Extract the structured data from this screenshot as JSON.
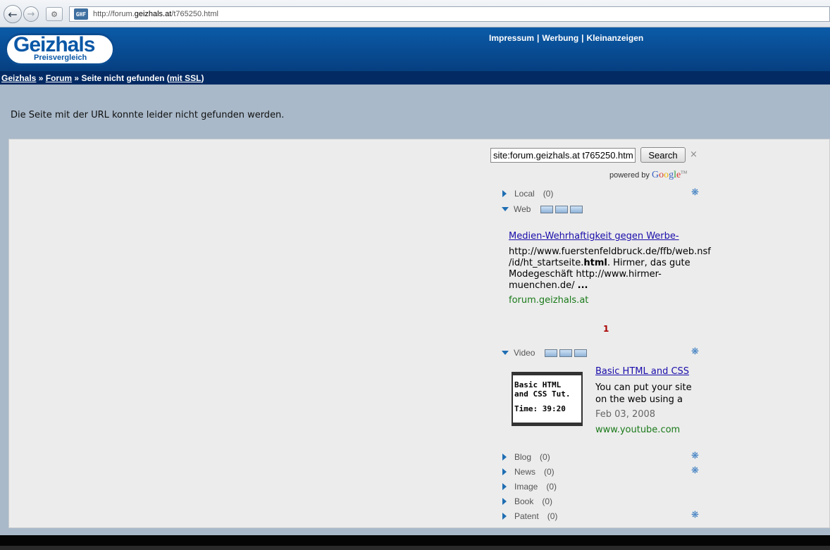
{
  "browser": {
    "url_prefix": "http://forum.",
    "url_domain": "geizhals.at",
    "url_path": "/t765250.html",
    "favicon_text": "GHF"
  },
  "header": {
    "logo_main": "Geizhals",
    "logo_sub": "Preisvergleich",
    "links": [
      "Impressum",
      "Werbung",
      "Kleinanzeigen"
    ]
  },
  "breadcrumb": {
    "home": "Geizhals",
    "sep": "»",
    "forum": "Forum",
    "current": "Seite nicht gefunden (",
    "ssl": "mit SSL",
    "close_paren": ")"
  },
  "message": "Die Seite mit der URL konnte leider nicht gefunden werden.",
  "search": {
    "query": "site:forum.geizhals.at t765250.html",
    "button": "Search",
    "clear": "×",
    "powered_by": "powered by"
  },
  "categories": {
    "local": {
      "label": "Local",
      "count": "(0)"
    },
    "web": {
      "label": "Web"
    },
    "video": {
      "label": "Video"
    },
    "blog": {
      "label": "Blog",
      "count": "(0)"
    },
    "news": {
      "label": "News",
      "count": "(0)"
    },
    "image": {
      "label": "Image",
      "count": "(0)"
    },
    "book": {
      "label": "Book",
      "count": "(0)"
    },
    "patent": {
      "label": "Patent",
      "count": "(0)"
    }
  },
  "web_result": {
    "title": "Medien-Wehrhaftigkeit gegen Werbe-",
    "snippet_1": "http://www.fuerstenfeldbruck.de/ffb/web.nsf /id/ht_startseite.",
    "snippet_bold": "html",
    "snippet_2": ". Hirmer, das gute Modegeschäft http://www.hirmer-muenchen.de/ ",
    "snippet_ellipsis": "...",
    "url": "forum.geizhals.at"
  },
  "pager": "1",
  "video_result": {
    "thumb_line1": "Basic HTML",
    "thumb_line2": "and CSS Tut.",
    "thumb_time": "Time: 39:20",
    "title": "Basic HTML and CSS",
    "snippet": "You can put your site on the web using a",
    "date": "Feb 03, 2008",
    "url": "www.youtube.com"
  }
}
